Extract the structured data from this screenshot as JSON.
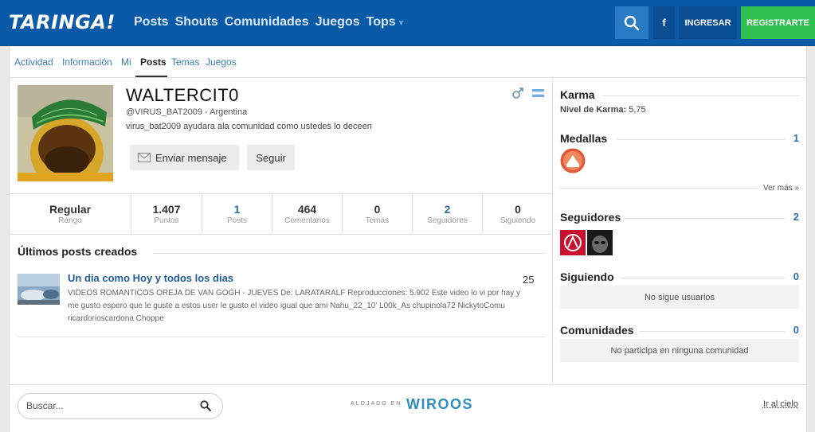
{
  "header": {
    "logo": "TARINGA!",
    "nav": [
      {
        "label": "Posts"
      },
      {
        "label": "Shouts"
      },
      {
        "label": "Comunidades"
      },
      {
        "label": "Juegos"
      },
      {
        "label": "Tops"
      }
    ],
    "facebook_label": "f",
    "login_label": "INGRESAR",
    "register_label": "REGISTRARTE"
  },
  "subnav": {
    "tabs": [
      "Actividad",
      "Información",
      "Mi",
      "Posts",
      "Temas",
      "Juegos"
    ],
    "active": "Posts"
  },
  "profile": {
    "username": "WALTERCIT0",
    "handle": "@VIRUS_BAT2009 - Argentina",
    "bio": "virus_bat2009 ayudara ala comunidad como ustedes lo deceen",
    "message_button": "Enviar mensaje",
    "follow_button": "Seguir"
  },
  "stats": [
    {
      "value": "Regular",
      "label": "Rango"
    },
    {
      "value": "1.407",
      "label": "Puntos"
    },
    {
      "value": "1",
      "label": "Posts"
    },
    {
      "value": "464",
      "label": "Comentarios"
    },
    {
      "value": "0",
      "label": "Temas"
    },
    {
      "value": "2",
      "label": "Seguidores"
    },
    {
      "value": "0",
      "label": "Siguiendo"
    }
  ],
  "posts_section": {
    "title": "Últimos posts creados",
    "posts": [
      {
        "title": "Un dia como Hoy y todos los dias",
        "count": "25",
        "description": "VIDEOS ROMANTICOS OREJA DE VAN GOGH - JUEVES De: LARATARALF Reproducciones: 5.902 Este video lo vi por hay y me gusto espero que le guste a estos user le gusto el video igual que ami Nahu_22_10' L00k_As chupinola72 NickytoComu ricardorioscardona Choppe"
      }
    ]
  },
  "sidebar": {
    "karma": {
      "title": "Karma",
      "label": "Nivel de Karma:",
      "value": "5,75"
    },
    "medals": {
      "title": "Medallas",
      "count": "1",
      "more": "Ver más »"
    },
    "followers": {
      "title": "Seguidores",
      "count": "2"
    },
    "following": {
      "title": "Siguiendo",
      "count": "0",
      "empty": "No sigue usuarios"
    },
    "communities": {
      "title": "Comunidades",
      "count": "0",
      "empty": "No participa en ninguna comunidad"
    }
  },
  "footer": {
    "search_placeholder": "Buscar...",
    "hosted_label": "ALOJADO EN",
    "host_name": "WIROOS",
    "to_top": "Ir al cielo"
  },
  "colors": {
    "header_bg": "#0b5aa8",
    "register_bg": "#2fbf4f",
    "link": "#2d6ea8"
  }
}
